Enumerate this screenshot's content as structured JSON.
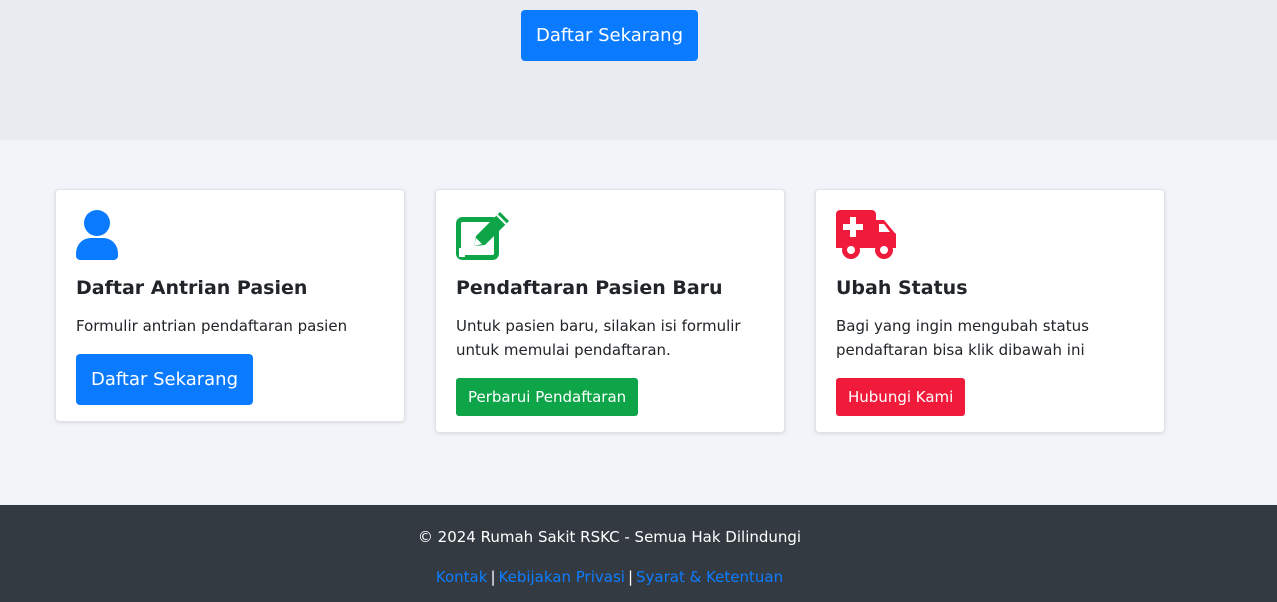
{
  "hero": {
    "cta_label": "Daftar Sekarang"
  },
  "cards": [
    {
      "icon": "user-icon",
      "title": "Daftar Antrian Pasien",
      "text": "Formulir antrian pendaftaran pasien",
      "button_label": "Daftar Sekarang",
      "color": "#0a7bff"
    },
    {
      "icon": "edit-icon",
      "title": "Pendaftaran Pasien Baru",
      "text": "Untuk pasien baru, silakan isi formulir untuk memulai pendaftaran.",
      "button_label": "Perbarui Pendaftaran",
      "color": "#0ea548"
    },
    {
      "icon": "ambulance-icon",
      "title": "Ubah Status",
      "text": "Bagi yang ingin mengubah status pendaftaran bisa klik dibawah ini",
      "button_label": "Hubungi Kami",
      "color": "#f01b3b"
    }
  ],
  "footer": {
    "copyright": "© 2024 Rumah Sakit RSKC - Semua Hak Dilindungi",
    "separator": "|",
    "links": [
      "Kontak",
      "Kebijakan Privasi",
      "Syarat & Ketentuan"
    ]
  }
}
